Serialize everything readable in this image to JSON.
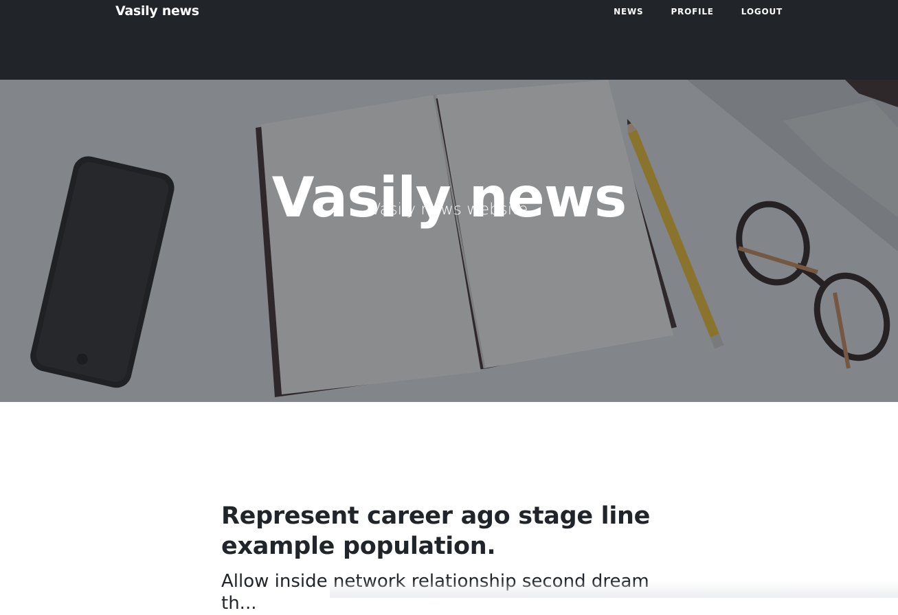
{
  "navbar": {
    "brand": "Vasily news",
    "links": [
      {
        "label": "NEWS"
      },
      {
        "label": "PROFILE"
      },
      {
        "label": "LOGOUT"
      }
    ]
  },
  "hero": {
    "title": "Vasily news",
    "subtitle": "Vasily news website",
    "overlay_color": "#212529"
  },
  "post": {
    "title": "Represent career ago stage line example population.",
    "subtitle": "Allow inside network relationship second dream th..."
  }
}
